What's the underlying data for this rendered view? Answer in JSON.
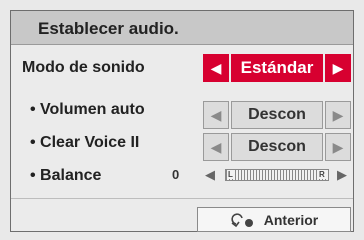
{
  "header": {
    "title": "Establecer audio."
  },
  "settings": {
    "sound_mode": {
      "label": "Modo de sonido",
      "value": "Estándar"
    },
    "auto_volume": {
      "label": "• Volumen auto",
      "value": "Descon"
    },
    "clear_voice": {
      "label": "• Clear Voice II",
      "value": "Descon"
    },
    "balance": {
      "label": "• Balance",
      "value": "0",
      "left_letter": "L",
      "right_letter": "R"
    }
  },
  "footer": {
    "back_label": "Anterior"
  },
  "icons": {
    "left_arrow": "◀",
    "right_arrow": "▶"
  },
  "colors": {
    "accent": "#d70030",
    "panel_bg": "#ebebeb",
    "header_bg": "#c8c8c8"
  }
}
